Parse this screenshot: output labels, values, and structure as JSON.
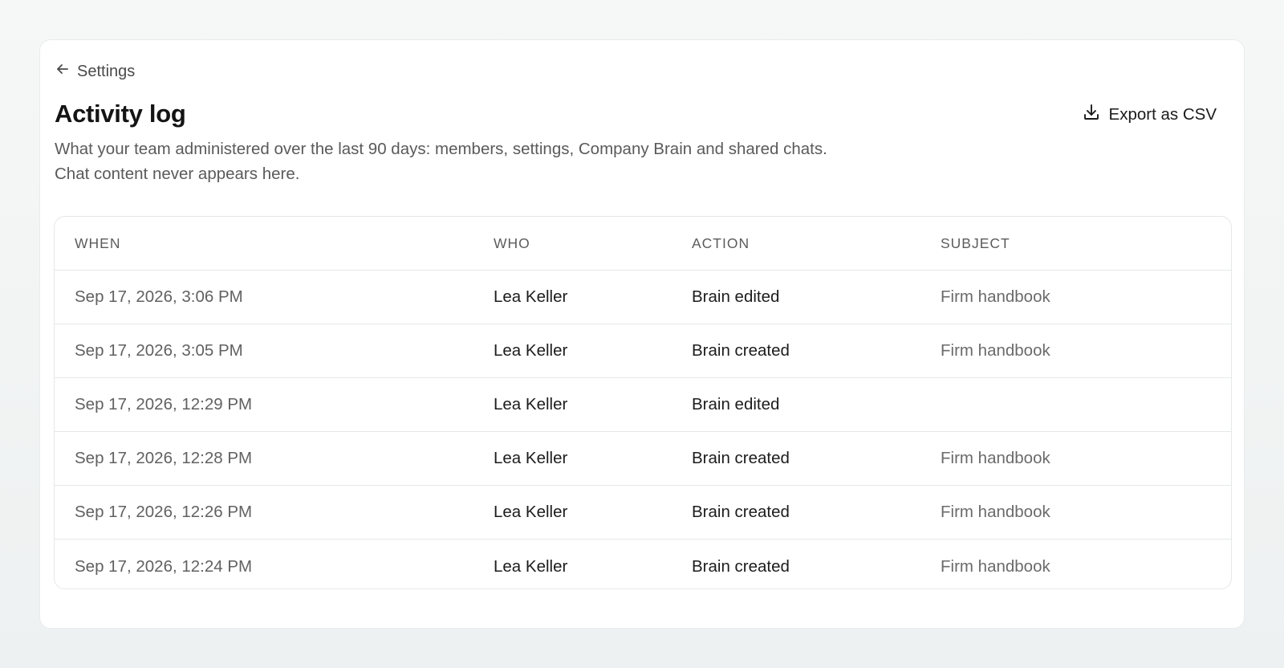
{
  "nav": {
    "back_label": "Settings"
  },
  "page": {
    "title": "Activity log",
    "subtitle": "What your team administered over the last 90 days: members, settings, Company Brain and shared chats. Chat content never appears here.",
    "export_label": "Export as CSV"
  },
  "table": {
    "columns": [
      "WHEN",
      "WHO",
      "ACTION",
      "SUBJECT"
    ],
    "rows": [
      {
        "when": "Sep 17, 2026, 3:06 PM",
        "who": "Lea Keller",
        "action": "Brain edited",
        "subject": "Firm handbook"
      },
      {
        "when": "Sep 17, 2026, 3:05 PM",
        "who": "Lea Keller",
        "action": "Brain created",
        "subject": "Firm handbook"
      },
      {
        "when": "Sep 17, 2026, 12:29 PM",
        "who": "Lea Keller",
        "action": "Brain edited",
        "subject": ""
      },
      {
        "when": "Sep 17, 2026, 12:28 PM",
        "who": "Lea Keller",
        "action": "Brain created",
        "subject": "Firm handbook"
      },
      {
        "when": "Sep 17, 2026, 12:26 PM",
        "who": "Lea Keller",
        "action": "Brain created",
        "subject": "Firm handbook"
      },
      {
        "when": "Sep 17, 2026, 12:24 PM",
        "who": "Lea Keller",
        "action": "Brain created",
        "subject": "Firm handbook"
      }
    ]
  }
}
